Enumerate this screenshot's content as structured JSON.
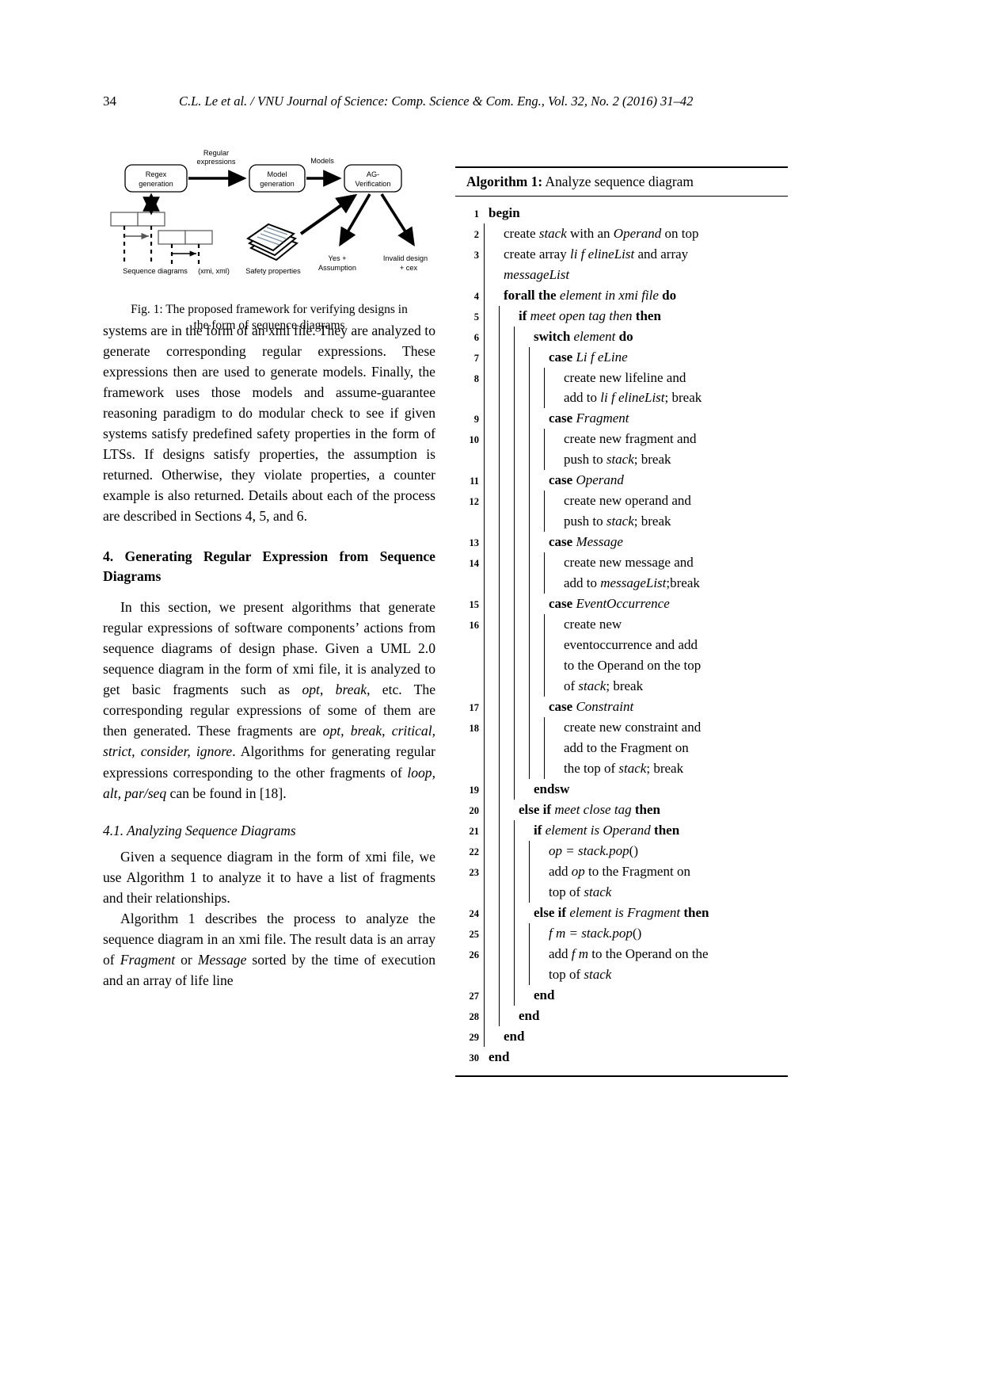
{
  "running_head": {
    "folio": "34",
    "text": "C.L. Le et al. / VNU Journal of Science: Comp. Science & Com. Eng., Vol. 32, No. 2 (2016) 31–42"
  },
  "figure": {
    "nodes": [
      {
        "id": "regex-generation",
        "label_line1": "Regex",
        "label_line2": "generation"
      },
      {
        "id": "model-generation",
        "label_line1": "Model",
        "label_line2": "generation"
      },
      {
        "id": "ag-verification",
        "label_line1": "AG-",
        "label_line2": "Verification"
      }
    ],
    "edge_labels": {
      "regular_expressions_line1": "Regular",
      "regular_expressions_line2": "expressions",
      "models": "Models"
    },
    "captions": {
      "sequence_diagrams": "Sequence diagrams",
      "xmi_xml": "(xmi, xml)",
      "safety_properties": "Safety properties",
      "yes_line1": "Yes +",
      "yes_line2": "Assumption",
      "invalid_line1": "Invalid design",
      "invalid_line2": "+ cex"
    },
    "caption_line1": "Fig. 1: The proposed framework for verifying designs in",
    "caption_line2": "the form of sequence diagrams"
  },
  "left_column": {
    "paragraph_1": "systems are in the form of an xmi file. They are analyzed to generate corresponding regular expressions. These expressions then are used to generate models. Finally, the framework uses those models and assume-guarantee reasoning paradigm to do modular check to see if given systems satisfy predefined safety properties in the form of LTSs. If designs satisfy properties, the assumption is returned. Otherwise, they violate properties, a counter example is also returned. Details about each of the process are described in Sections 4, 5, and 6.",
    "section_heading": "4. Generating Regular Expression from Sequence Diagrams",
    "paragraph_2_a": "In this section, we present algorithms that generate regular expressions of software components’ actions from sequence diagrams of design phase. Given a UML 2.0 sequence diagram in the form of xmi file, it is analyzed to get basic fragments such as ",
    "paragraph_2_it1": "opt",
    "paragraph_2_b": ", ",
    "paragraph_2_it2": "break",
    "paragraph_2_c": ", etc. The corresponding regular expressions of some of them are then generated. These fragments are ",
    "paragraph_2_it3": "opt, break, critical, strict, consider, ignore",
    "paragraph_2_d": ". Algorithms for generating regular expressions corresponding to the other fragments of ",
    "paragraph_2_it4": "loop, alt, par/seq",
    "paragraph_2_e": " can be found in [18].",
    "subsection_heading": "4.1. Analyzing Sequence Diagrams",
    "paragraph_3": "Given a sequence diagram in the form of xmi file, we use Algorithm 1 to analyze it to have a list of fragments and their relationships.",
    "paragraph_4_a": "Algorithm 1 describes the process to analyze the sequence diagram in an xmi file. The result data is an array of ",
    "paragraph_4_it1": "Fragment",
    "paragraph_4_b": " or ",
    "paragraph_4_it2": "Message",
    "paragraph_4_c": " sorted by the time of execution and an array of life line"
  },
  "algorithm": {
    "title_bold": "Algorithm 1:",
    "title_rest": " Analyze sequence diagram",
    "lines": [
      {
        "num": "1",
        "depth": 0,
        "html": "<b>begin</b>"
      },
      {
        "num": "2",
        "depth": 1,
        "html": "create <i>stack</i> with an <i>Operand</i> on top"
      },
      {
        "num": "3",
        "depth": 1,
        "html": "create array <i>li f elineList</i> and array"
      },
      {
        "num": "",
        "depth": 1,
        "html": "<i>messageList</i>"
      },
      {
        "num": "4",
        "depth": 1,
        "html": "<b>forall the</b> <i>element in xmi file</i> <b>do</b>"
      },
      {
        "num": "5",
        "depth": 2,
        "html": "<b>if</b> <i>meet open tag then</i> <b>then</b>"
      },
      {
        "num": "6",
        "depth": 3,
        "html": "<b>switch</b> <i>element</i> <b>do</b>"
      },
      {
        "num": "7",
        "depth": 4,
        "html": "<b>case</b> <i>Li f eLine</i>"
      },
      {
        "num": "8",
        "depth": 5,
        "html": "create new lifeline and"
      },
      {
        "num": "",
        "depth": 5,
        "html": "add to <i>li f elineList</i>; break"
      },
      {
        "num": "9",
        "depth": 4,
        "html": "<b>case</b> <i>Fragment</i>"
      },
      {
        "num": "10",
        "depth": 5,
        "html": "create new fragment and"
      },
      {
        "num": "",
        "depth": 5,
        "html": "push to <i>stack</i>; break"
      },
      {
        "num": "11",
        "depth": 4,
        "html": "<b>case</b> <i>Operand</i>"
      },
      {
        "num": "12",
        "depth": 5,
        "html": "create new operand and"
      },
      {
        "num": "",
        "depth": 5,
        "html": "push to <i>stack</i>; break"
      },
      {
        "num": "13",
        "depth": 4,
        "html": "<b>case</b> <i>Message</i>"
      },
      {
        "num": "14",
        "depth": 5,
        "html": "create new message and"
      },
      {
        "num": "",
        "depth": 5,
        "html": "add to <i>messageList</i>;break"
      },
      {
        "num": "15",
        "depth": 4,
        "html": "<b>case</b> <i>EventOccurrence</i>"
      },
      {
        "num": "16",
        "depth": 5,
        "html": "create new"
      },
      {
        "num": "",
        "depth": 5,
        "html": "eventoccurrence and add"
      },
      {
        "num": "",
        "depth": 5,
        "html": "to the Operand on the top"
      },
      {
        "num": "",
        "depth": 5,
        "html": "of <i>stack</i>; break"
      },
      {
        "num": "17",
        "depth": 4,
        "html": "<b>case</b> <i>Constraint</i>"
      },
      {
        "num": "18",
        "depth": 5,
        "html": "create new constraint and"
      },
      {
        "num": "",
        "depth": 5,
        "html": "add to the Fragment on"
      },
      {
        "num": "",
        "depth": 5,
        "html": "the top of <i>stack</i>; break"
      },
      {
        "num": "19",
        "depth": 3,
        "html": "<b>endsw</b>"
      },
      {
        "num": "20",
        "depth": 2,
        "html": "<b>else if</b> <i>meet close tag</i> <b>then</b>"
      },
      {
        "num": "21",
        "depth": 3,
        "html": "<b>if</b> <i>element is Operand</i> <b>then</b>"
      },
      {
        "num": "22",
        "depth": 4,
        "html": "<i>op = stack.pop</i>()"
      },
      {
        "num": "23",
        "depth": 4,
        "html": "add <i>op</i> to the Fragment on"
      },
      {
        "num": "",
        "depth": 4,
        "html": "top of <i>stack</i>"
      },
      {
        "num": "24",
        "depth": 3,
        "html": "<b>else if</b> <i>element is Fragment</i> <b>then</b>"
      },
      {
        "num": "25",
        "depth": 4,
        "html": "<i>f m = stack.pop</i>()"
      },
      {
        "num": "26",
        "depth": 4,
        "html": "add <i>f m</i> to the Operand on the"
      },
      {
        "num": "",
        "depth": 4,
        "html": "top of <i>stack</i>"
      },
      {
        "num": "27",
        "depth": 3,
        "html": "<b>end</b>"
      },
      {
        "num": "28",
        "depth": 2,
        "html": "<b>end</b>"
      },
      {
        "num": "29",
        "depth": 1,
        "html": "<b>end</b>"
      },
      {
        "num": "30",
        "depth": 0,
        "html": "<b>end</b>"
      }
    ]
  }
}
